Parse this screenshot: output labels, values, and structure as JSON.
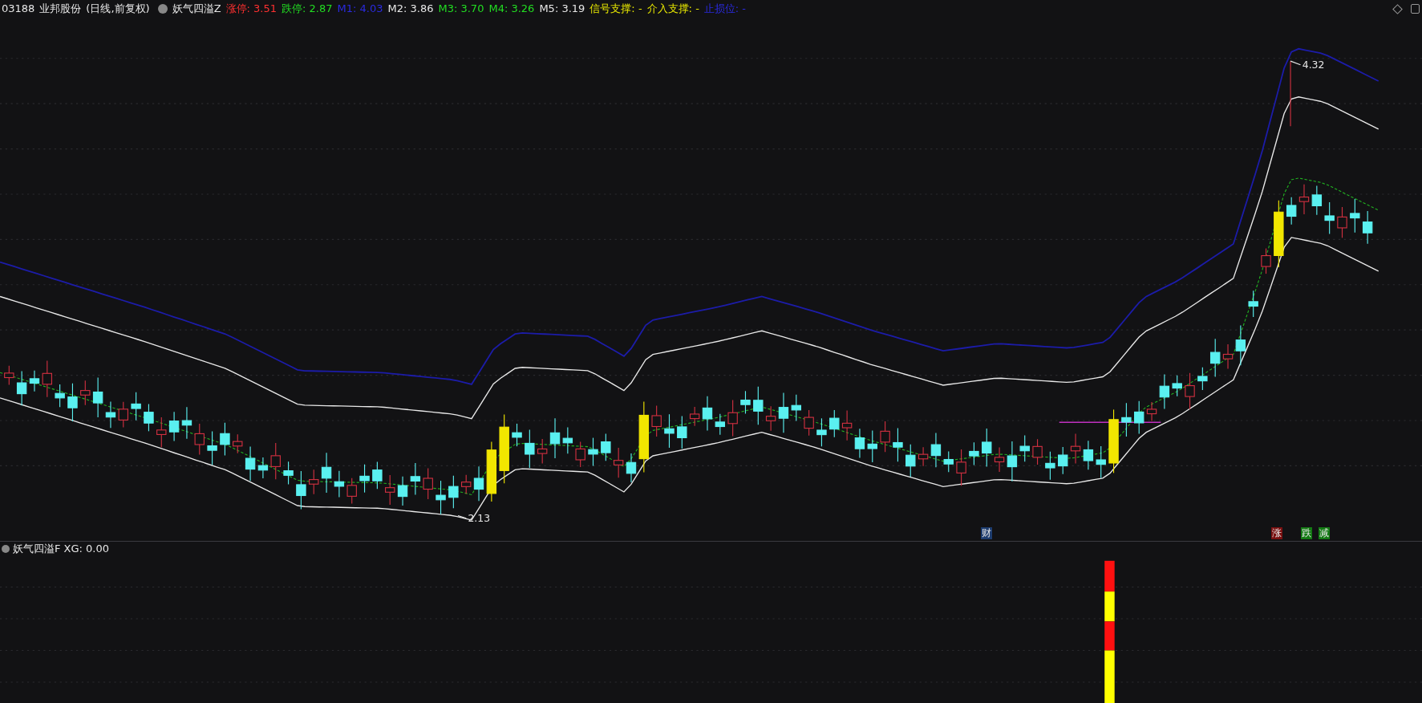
{
  "header": {
    "code": "03188",
    "name": "业邦股份",
    "period": "(日线,前复权)",
    "indicator": "妖气四溢Z",
    "values": [
      {
        "label": "涨停:",
        "value": "3.51",
        "color": "#ff3030"
      },
      {
        "label": "跌停:",
        "value": "2.87",
        "color": "#22dd22"
      },
      {
        "label": "M1:",
        "value": "4.03",
        "color": "#2a2ae0"
      },
      {
        "label": "M2:",
        "value": "3.86",
        "color": "#e6e6e6"
      },
      {
        "label": "M3:",
        "value": "3.70",
        "color": "#22dd22"
      },
      {
        "label": "M4:",
        "value": "3.26",
        "color": "#22dd22"
      },
      {
        "label": "M5:",
        "value": "3.19",
        "color": "#e6e6e6"
      },
      {
        "label": "信号支撑:",
        "value": "-",
        "color": "#e8e800"
      },
      {
        "label": "介入支撑:",
        "value": "-",
        "color": "#e8e800"
      },
      {
        "label": "止损位:",
        "value": "-",
        "color": "#2a2ae0"
      }
    ]
  },
  "price_labels": [
    {
      "text": "4.32"
    },
    {
      "text": "2.13"
    }
  ],
  "event_markers": [
    {
      "text": "财",
      "color": "#1d3c6e"
    },
    {
      "text": "涨",
      "color": "#7a1010"
    },
    {
      "text": "跌",
      "color": "#137a13"
    },
    {
      "text": "减",
      "color": "#137a13"
    }
  ],
  "lower_panel": {
    "indicator": "妖气四溢F",
    "reading": "XG: 0.00"
  }
}
